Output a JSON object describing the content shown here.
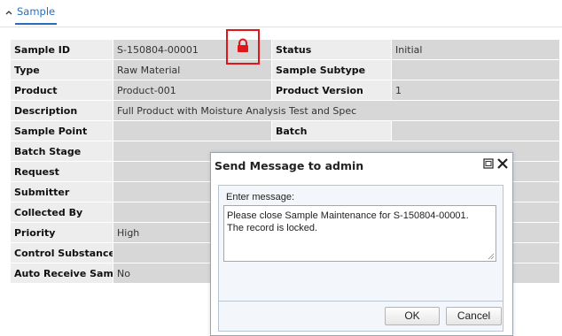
{
  "section": {
    "tab_label": "Sample"
  },
  "fields": {
    "rows": [
      {
        "label": "Sample ID",
        "value": "S-150804-00001",
        "label2": "Status",
        "value2": "Initial"
      },
      {
        "label": "Type",
        "value": "Raw Material",
        "label2": "Sample Subtype",
        "value2": ""
      },
      {
        "label": "Product",
        "value": "Product-001",
        "label2": "Product Version",
        "value2": "1"
      },
      {
        "label": "Description",
        "value": "Full Product with Moisture Analysis Test and Spec"
      },
      {
        "label": "Sample Point",
        "value": "",
        "label2": "Batch",
        "value2": ""
      },
      {
        "label": "Batch Stage",
        "value": "",
        "label2": "",
        "value2": ""
      },
      {
        "label": "Request",
        "value": "",
        "label2": "",
        "value2": ""
      },
      {
        "label": "Submitter",
        "value": "",
        "label2": "",
        "value2": ""
      },
      {
        "label": "Collected By",
        "value": "",
        "label2": "",
        "value2": ""
      },
      {
        "label": "Priority",
        "value": "High",
        "label2": "",
        "value2": ""
      },
      {
        "label": "Control Substance",
        "value": "",
        "label2": "",
        "value2": ""
      },
      {
        "label": "Auto Receive Sample",
        "value": "No",
        "label2": "",
        "value2": ""
      }
    ]
  },
  "lock": {
    "icon": "lock-icon",
    "color": "#e0161b"
  },
  "dialog": {
    "title": "Send Message to admin",
    "message_label": "Enter message:",
    "message_lines": [
      "Please close Sample Maintenance for S-150804-00001.",
      "The record is locked."
    ],
    "ok_label": "OK",
    "cancel_label": "Cancel"
  },
  "colors": {
    "accent": "#2a6ebb",
    "label_bg": "#ededed",
    "value_bg": "#d7d7d7"
  }
}
